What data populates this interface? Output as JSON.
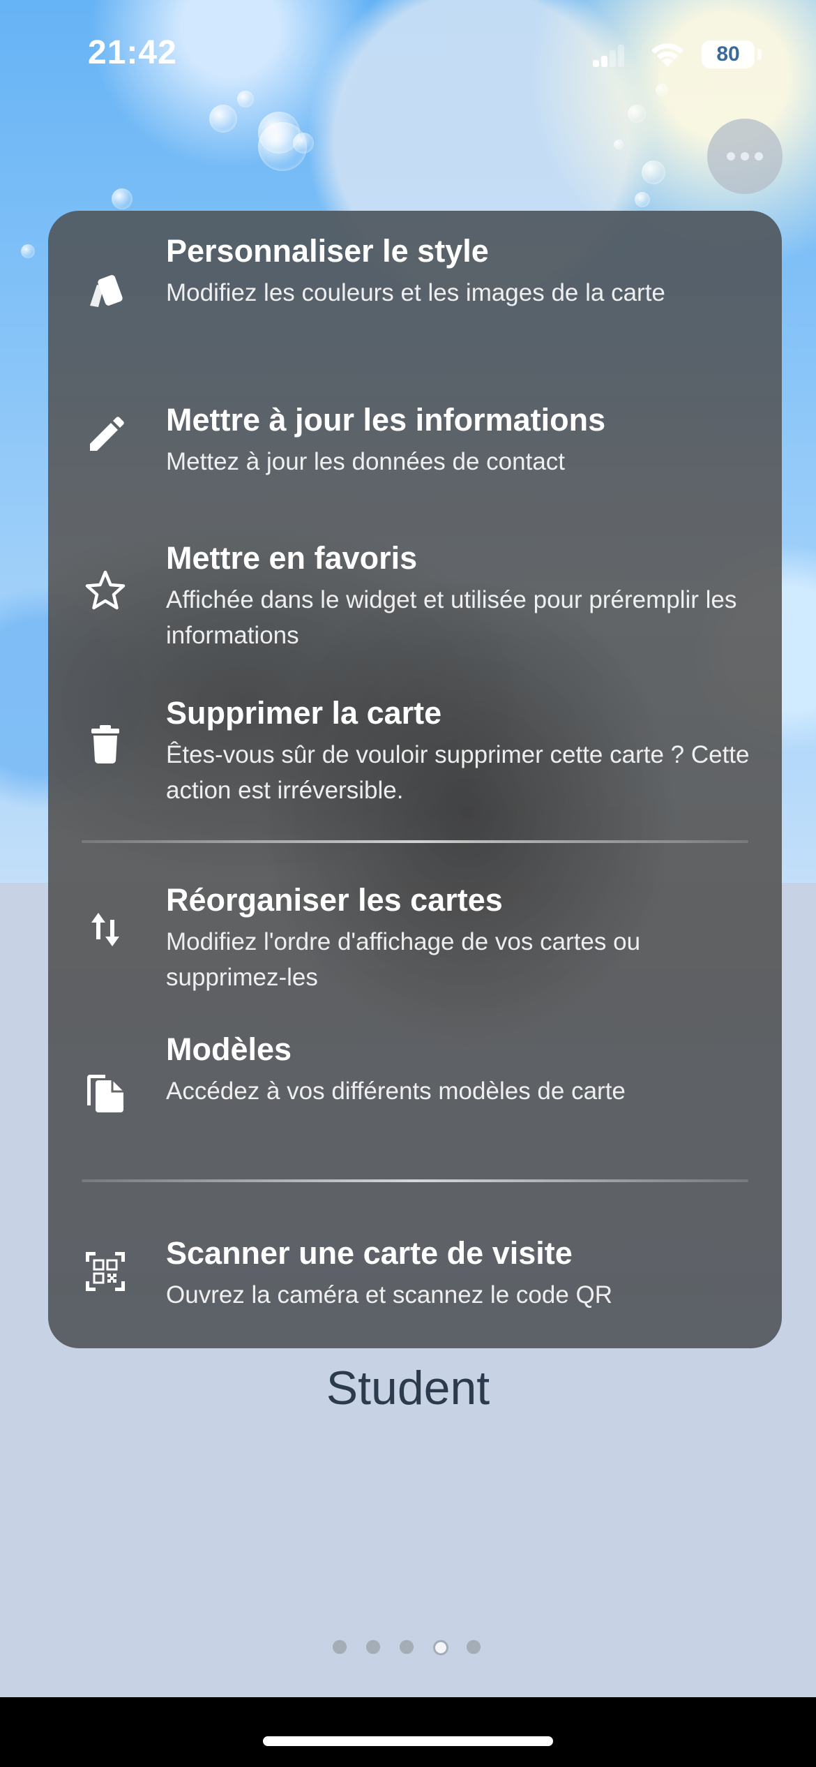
{
  "status_bar": {
    "time": "21:42",
    "battery": "80"
  },
  "menu": {
    "items": [
      {
        "title": "Personnaliser le style",
        "description": "Modifiez les couleurs et les images de la carte",
        "icon": "cards-style-icon"
      },
      {
        "title": "Mettre à jour les informations",
        "description": "Mettez à jour les données de contact",
        "icon": "pencil-icon"
      },
      {
        "title": "Mettre en favoris",
        "description": "Affichée dans le widget et utilisée pour préremplir les informations",
        "icon": "star-icon"
      },
      {
        "title": "Supprimer la carte",
        "description": "Êtes-vous sûr de vouloir supprimer cette carte ? Cette action est irréversible.",
        "icon": "trash-icon"
      },
      {
        "title": "Réorganiser les cartes",
        "description": "Modifiez l'ordre d'affichage de vos cartes ou supprimez-les",
        "icon": "reorder-arrows-icon"
      },
      {
        "title": "Modèles",
        "description": "Accédez à vos différents modèles de carte",
        "icon": "templates-icon"
      },
      {
        "title": "Scanner une carte de visite",
        "description": "Ouvrez la caméra et scannez le code QR",
        "icon": "qr-scan-icon"
      }
    ]
  },
  "card": {
    "name": "Student"
  },
  "pager": {
    "count": 5,
    "active_index": 3
  },
  "colors": {
    "menu_background": "#5c5c5c",
    "page_background": "#c7d3e4",
    "text_primary": "#ffffff",
    "card_name": "#2c3a4e"
  }
}
